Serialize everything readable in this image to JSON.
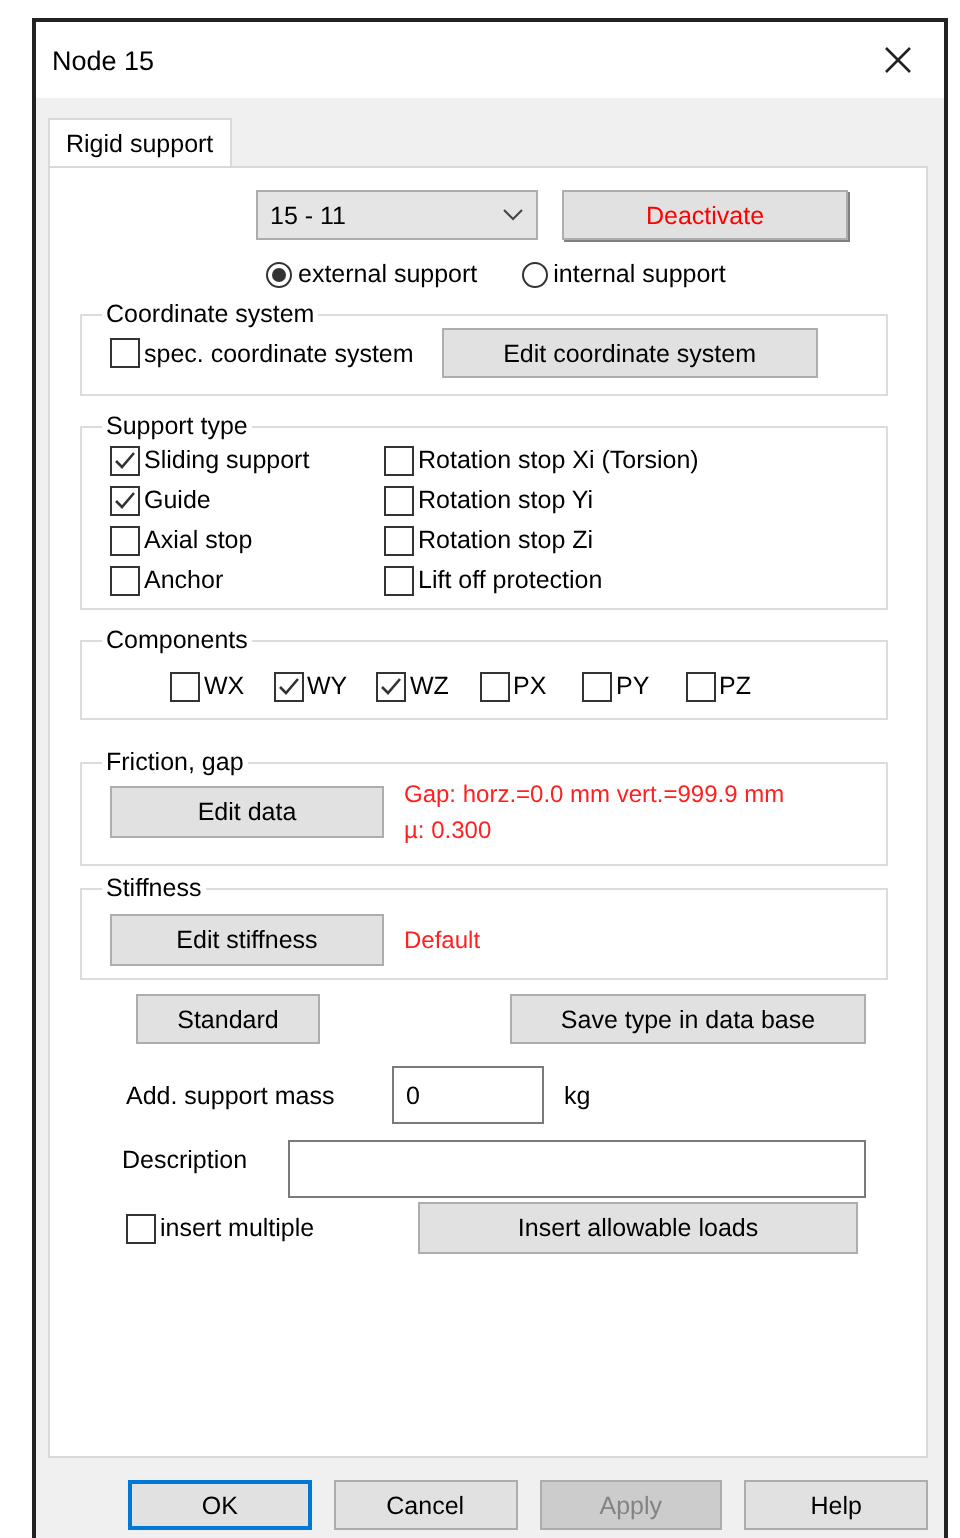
{
  "window": {
    "title": "Node 15"
  },
  "tabs": [
    {
      "label": "Rigid support",
      "selected": true
    }
  ],
  "support_select": {
    "value": "15 - 11"
  },
  "deactivate_button": "Deactivate",
  "support_location": [
    {
      "label": "external support",
      "selected": true
    },
    {
      "label": "internal support",
      "selected": false
    }
  ],
  "coordinate_system": {
    "title": "Coordinate system",
    "checkbox": {
      "label": "spec. coordinate system",
      "checked": false
    },
    "button": "Edit coordinate system"
  },
  "support_type": {
    "title": "Support type",
    "options": [
      {
        "label": "Sliding support",
        "checked": true
      },
      {
        "label": "Rotation stop Xi (Torsion)",
        "checked": false
      },
      {
        "label": "Guide",
        "checked": true
      },
      {
        "label": "Rotation stop Yi",
        "checked": false
      },
      {
        "label": "Axial stop",
        "checked": false
      },
      {
        "label": "Rotation stop Zi",
        "checked": false
      },
      {
        "label": "Anchor",
        "checked": false
      },
      {
        "label": "Lift off protection",
        "checked": false
      }
    ]
  },
  "components": {
    "title": "Components",
    "options": [
      {
        "label": "WX",
        "checked": false
      },
      {
        "label": "WY",
        "checked": true
      },
      {
        "label": "WZ",
        "checked": true
      },
      {
        "label": "PX",
        "checked": false
      },
      {
        "label": "PY",
        "checked": false
      },
      {
        "label": "PZ",
        "checked": false
      }
    ]
  },
  "friction_gap": {
    "title": "Friction, gap",
    "button": "Edit data",
    "info": [
      "Gap:  horz.=0.0 mm vert.=999.9 mm",
      "µ: 0.300"
    ]
  },
  "stiffness": {
    "title": "Stiffness",
    "button": "Edit stiffness",
    "info": "Default"
  },
  "standard_button": "Standard",
  "save_button": "Save type in data base",
  "support_mass": {
    "label": "Add. support mass",
    "value": "0",
    "unit": "kg"
  },
  "description": {
    "label": "Description"
  },
  "insert_multiple": {
    "label": "insert multiple",
    "checked": false
  },
  "insert_loads_button": "Insert allowable loads",
  "buttons": [
    {
      "label": "OK",
      "kind": "default",
      "disabled": false
    },
    {
      "label": "Cancel",
      "kind": "normal",
      "disabled": false
    },
    {
      "label": "Apply",
      "kind": "normal",
      "disabled": true
    },
    {
      "label": "Help",
      "kind": "normal",
      "disabled": false
    }
  ]
}
